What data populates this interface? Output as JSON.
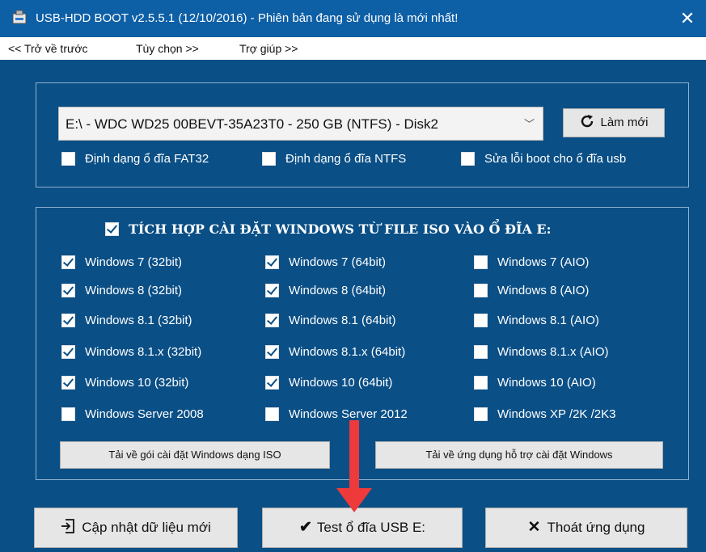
{
  "window": {
    "title": "USB-HDD BOOT v2.5.5.1 (12/10/2016) - Phiên bản đang sử dụng là mới nhất!",
    "close": "✕"
  },
  "menu": {
    "back": "<< Trở về trước",
    "options": "Tùy chọn >>",
    "help": "Trợ giúp >>"
  },
  "drive": {
    "selected": "E:\\ - WDC WD25 00BEVT-35A23T0 - 250 GB (NTFS) - Disk2",
    "refresh_label": "Làm mới",
    "options": [
      {
        "label": "Định dạng ổ đĩa FAT32",
        "checked": false
      },
      {
        "label": "Định dạng ổ đĩa NTFS",
        "checked": false
      },
      {
        "label": "Sửa lỗi boot cho ổ đĩa usb",
        "checked": false
      }
    ]
  },
  "integrate": {
    "title": "TÍCH HỢP CÀI ĐẶT WINDOWS TỪ FILE ISO VÀO Ổ ĐĨA E:",
    "title_checked": true,
    "items": [
      {
        "label": "Windows 7 (32bit)",
        "checked": true
      },
      {
        "label": "Windows 7 (64bit)",
        "checked": true
      },
      {
        "label": "Windows 7 (AIO)",
        "checked": false
      },
      {
        "label": "Windows 8 (32bit)",
        "checked": true
      },
      {
        "label": "Windows 8 (64bit)",
        "checked": true
      },
      {
        "label": "Windows 8 (AIO)",
        "checked": false
      },
      {
        "label": "Windows 8.1 (32bit)",
        "checked": true
      },
      {
        "label": "Windows 8.1 (64bit)",
        "checked": true
      },
      {
        "label": "Windows 8.1 (AIO)",
        "checked": false
      },
      {
        "label": "Windows 8.1.x (32bit)",
        "checked": true
      },
      {
        "label": "Windows 8.1.x (64bit)",
        "checked": true
      },
      {
        "label": "Windows 8.1.x (AIO)",
        "checked": false
      },
      {
        "label": "Windows 10 (32bit)",
        "checked": true
      },
      {
        "label": "Windows 10 (64bit)",
        "checked": true
      },
      {
        "label": "Windows 10 (AIO)",
        "checked": false
      },
      {
        "label": "Windows Server 2008",
        "checked": false
      },
      {
        "label": "Windows Server 2012",
        "checked": false
      },
      {
        "label": "Windows XP /2K /2K3",
        "checked": false
      }
    ],
    "download_iso": "Tải về gói cài đặt Windows dạng ISO",
    "download_tool": "Tải về ứng dụng hỗ trợ cài đặt Windows"
  },
  "actions": {
    "update": "Cập nhật dữ liệu mới",
    "test": "Test ổ đĩa USB E:",
    "exit": "Thoát ứng dụng"
  },
  "colors": {
    "background": "#0a4f86",
    "titlebar": "#0d5fa6",
    "arrow": "#ee3a3a"
  }
}
